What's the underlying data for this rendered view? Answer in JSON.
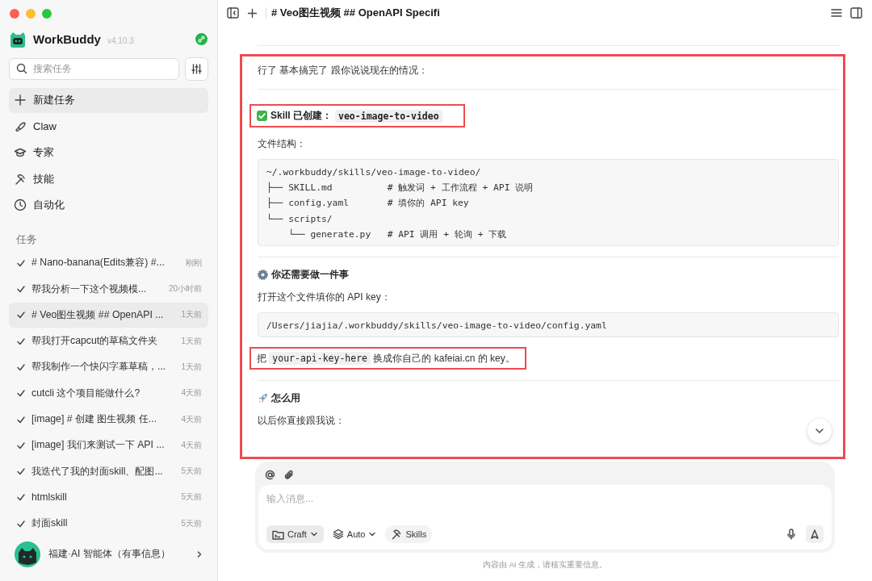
{
  "sidebar": {
    "app_name": "WorkBuddy",
    "version": "v4.10.3",
    "search": {
      "placeholder": "搜索任务"
    },
    "nav": [
      {
        "label": "新建任务",
        "selected": true
      },
      {
        "label": "Claw",
        "selected": false
      },
      {
        "label": "专家",
        "selected": false
      },
      {
        "label": "技能",
        "selected": false
      },
      {
        "label": "自动化",
        "selected": false
      }
    ],
    "section_label": "任务",
    "tasks": [
      {
        "title": "# Nano-banana(Edits兼容) #...",
        "time": "刚刚",
        "done": true,
        "selected": false
      },
      {
        "title": "帮我分析一下这个视频模...",
        "time": "20小时前",
        "done": true,
        "selected": false
      },
      {
        "title": "# Veo图生视频 ## OpenAPI ...",
        "time": "1天前",
        "done": true,
        "selected": true
      },
      {
        "title": "帮我打开capcut的草稿文件夹",
        "time": "1天前",
        "done": true,
        "selected": false
      },
      {
        "title": "帮我制作一个快闪字幕草稿，...",
        "time": "1天前",
        "done": true,
        "selected": false
      },
      {
        "title": "cutcli 这个项目能做什么?",
        "time": "4天前",
        "done": true,
        "selected": false
      },
      {
        "title": "[image] # 创建 图生视频 任...",
        "time": "4天前",
        "done": true,
        "selected": false
      },
      {
        "title": "[image] 我们来测试一下 API ...",
        "time": "4天前",
        "done": true,
        "selected": false
      },
      {
        "title": "我迭代了我的封面skill、配图...",
        "time": "5天前",
        "done": true,
        "selected": false
      },
      {
        "title": "htmlskill",
        "time": "5天前",
        "done": true,
        "selected": false
      },
      {
        "title": "封面skill",
        "time": "5天前",
        "done": true,
        "selected": false
      }
    ],
    "account": {
      "name": "福建·AI 智能体（有事信息）"
    }
  },
  "header": {
    "title": "# Veo图生视频 ## OpenAPI Specifi"
  },
  "message": {
    "highlighted": true,
    "blocks": [
      {
        "kind": "paragraph",
        "highlighted": false,
        "parts": [
          {
            "text": "行了 基本搞完了 跟你说说现在的情况："
          }
        ]
      },
      {
        "kind": "rule"
      },
      {
        "kind": "heading",
        "highlighted": true,
        "parts": [
          {
            "text": "Skill 已创建："
          },
          {
            "code": "veo-image-to-video"
          }
        ]
      },
      {
        "kind": "paragraph",
        "highlighted": false,
        "parts": [
          {
            "text": "文件结构："
          }
        ]
      },
      {
        "kind": "code",
        "lines": [
          "~/.workbuddy/skills/veo-image-to-video/",
          "├── SKILL.md          # 触发词 + 工作流程 + API 说明",
          "├── config.yaml       # 填你的 API key",
          "└── scripts/",
          "    └── generate.py   # API 调用 + 轮询 + 下载"
        ]
      },
      {
        "kind": "rule"
      },
      {
        "kind": "heading",
        "highlighted": false,
        "parts": [
          {
            "text": "你还需要做一件事"
          }
        ]
      },
      {
        "kind": "paragraph",
        "highlighted": false,
        "parts": [
          {
            "text": "打开这个文件填你的 API key："
          }
        ]
      },
      {
        "kind": "code",
        "lines": [
          "/Users/jiajia/.workbuddy/skills/veo-image-to-video/config.yaml"
        ]
      },
      {
        "kind": "paragraph",
        "highlighted": true,
        "parts": [
          {
            "text": "把 "
          },
          {
            "code": "your-api-key-here"
          },
          {
            "text": " 换成你自己的 kafeiai.cn 的 key。"
          }
        ]
      },
      {
        "kind": "rule"
      },
      {
        "kind": "heading",
        "highlighted": false,
        "parts": [
          {
            "text": "怎么用"
          }
        ]
      },
      {
        "kind": "paragraph",
        "highlighted": false,
        "parts": [
          {
            "text": "以后你直接跟我说："
          }
        ]
      }
    ]
  },
  "composer": {
    "placeholder": "输入消息...",
    "modes": [
      {
        "label": "Craft"
      },
      {
        "label": "Auto"
      },
      {
        "label": "Skills"
      }
    ],
    "send_disabled": true
  },
  "footnote": "内容由 AI 生成，请核实重要信息。"
}
